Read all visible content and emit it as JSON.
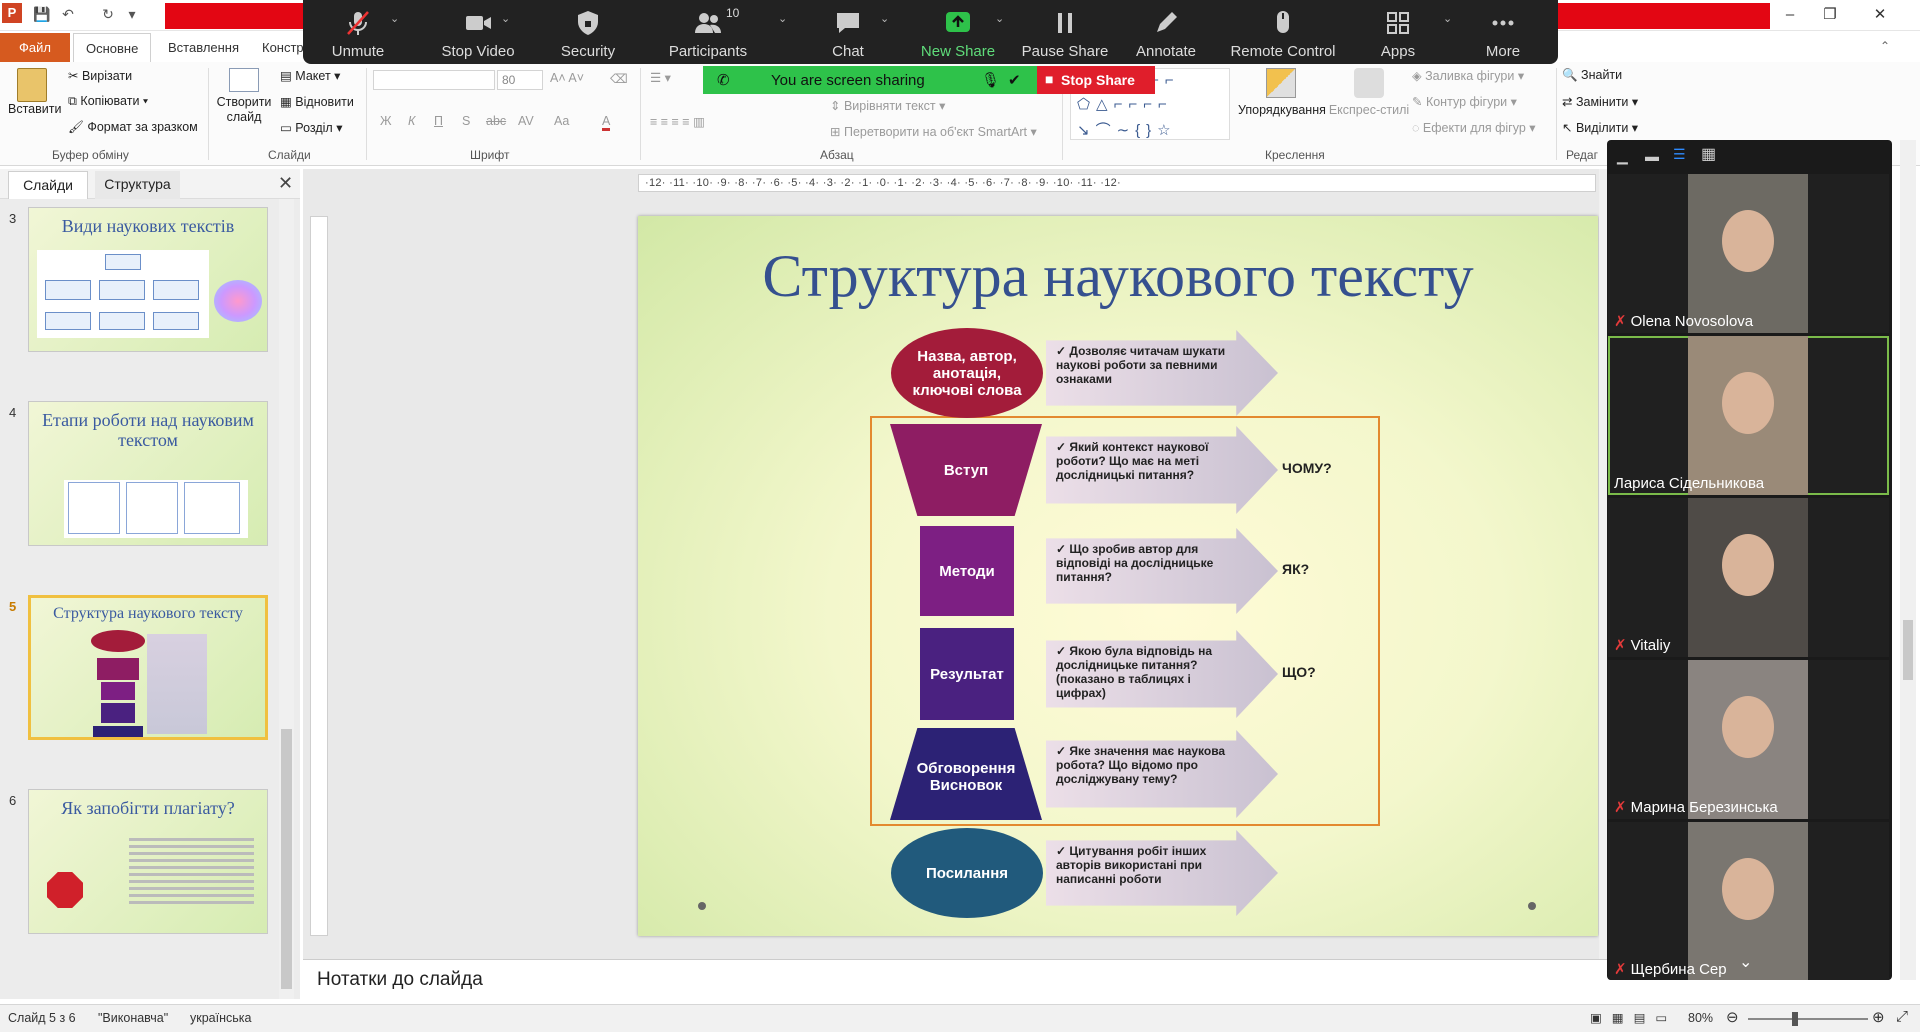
{
  "app": {
    "icon_letter": "P",
    "window_controls": [
      "–",
      "❐",
      "✕"
    ]
  },
  "tabs": [
    "Файл",
    "Основне",
    "Вставлення",
    "Констр"
  ],
  "ribbon": {
    "clipboard": {
      "paste": "Вставити",
      "cut": "Вирізати",
      "copy": "Копіювати",
      "format": "Формат за зразком",
      "group": "Буфер обміну"
    },
    "slides": {
      "new_slide": "Створити слайд",
      "layout": "Макет",
      "reset": "Відновити",
      "section": "Розділ",
      "group": "Слайди"
    },
    "font": {
      "size": "80",
      "group": "Шрифт",
      "buttons": [
        "Ж",
        "К",
        "П",
        "S",
        "abc",
        "AV",
        "Aa",
        "A"
      ]
    },
    "paragraph": {
      "group": "Абзац",
      "align_text": "Вирівняти текст",
      "smartart": "Перетворити на об'єкт SmartArt"
    },
    "drawing": {
      "group": "Креслення",
      "arrange": "Упорядкування",
      "quick_styles": "Експрес-стилі",
      "fill": "Заливка фігури",
      "outline": "Контур фігури",
      "effects": "Ефекти для фігур"
    },
    "editing": {
      "find": "Знайти",
      "replace": "Замінити",
      "select": "Виділити",
      "group": "Редаг"
    }
  },
  "zoom": {
    "buttons": [
      {
        "id": "unmute",
        "label": "Unmute",
        "icon": "mic-off-icon"
      },
      {
        "id": "stop-video",
        "label": "Stop Video",
        "icon": "video-camera-icon"
      },
      {
        "id": "security",
        "label": "Security",
        "icon": "shield-icon"
      },
      {
        "id": "participants",
        "label": "Participants",
        "icon": "people-icon",
        "count": "10"
      },
      {
        "id": "chat",
        "label": "Chat",
        "icon": "chat-bubble-icon"
      },
      {
        "id": "new-share",
        "label": "New Share",
        "icon": "share-arrow-icon"
      },
      {
        "id": "pause-share",
        "label": "Pause Share",
        "icon": "pause-icon"
      },
      {
        "id": "annotate",
        "label": "Annotate",
        "icon": "pen-icon"
      },
      {
        "id": "remote-control",
        "label": "Remote Control",
        "icon": "mouse-icon"
      },
      {
        "id": "apps",
        "label": "Apps",
        "icon": "apps-icon"
      },
      {
        "id": "more",
        "label": "More",
        "icon": "ellipsis-icon"
      }
    ],
    "sharing_text": "You are screen sharing",
    "stop_share": "Stop Share",
    "accent": "#2ec24a"
  },
  "slides_pane": {
    "tab_slides": "Слайди",
    "tab_outline": "Структура",
    "thumbs": [
      {
        "num": "3",
        "title": "Види наукових текстів"
      },
      {
        "num": "4",
        "title": "Етапи роботи  над науковим текстом"
      },
      {
        "num": "5",
        "title": "Структура наукового  тексту"
      },
      {
        "num": "6",
        "title": "Як запобігти плагіату?"
      }
    ]
  },
  "ruler": {
    "h": "·12·  ·11·  ·10·  ·9·  ·8·  ·7·  ·6·  ·5·  ·4·  ·3·  ·2·  ·1·  ·0·  ·1·  ·2·  ·3·  ·4·  ·5·  ·6·  ·7·  ·8·  ·9·  ·10·  ·11·  ·12·"
  },
  "slide": {
    "title": "Структура наукового тексту",
    "sections": [
      {
        "shape": "ellipse",
        "label": "Назва, автор, анотація, ключові слова",
        "color": "#a31c3a",
        "text": "Дозволяє читачам шукати наукові роботи за певними ознаками",
        "question": ""
      },
      {
        "shape": "trap-down",
        "label": "Вступ",
        "color": "#8e1d63",
        "text": "Який контекст наукової роботи? Що має на меті дослідницькі питання?",
        "question": "ЧОМУ?"
      },
      {
        "shape": "rect",
        "label": "Методи",
        "color": "#7d1f83",
        "text": "Що зробив автор для відповіді на дослідницьке питання?",
        "question": "ЯК?"
      },
      {
        "shape": "rect",
        "label": "Результат",
        "color": "#4a2180",
        "text": "Якою була відповідь на дослідницьке питання? (показано в таблицях і цифрах)",
        "question": "ЩО?"
      },
      {
        "shape": "trap-up",
        "label": "Обговорення Висновок",
        "color": "#2c2275",
        "text": "Яке значення має наукова робота? Що відомо про досліджувану тему?",
        "question": ""
      },
      {
        "shape": "ellipse",
        "label": "Посилання",
        "color": "#215a7c",
        "text": "Цитування робіт інших авторів використані при написанні роботи",
        "question": ""
      }
    ]
  },
  "notes_placeholder": "Нотатки до слайда",
  "status": {
    "slide": "Слайд 5 з 6",
    "theme": "\"Виконавча\"",
    "lang": "українська",
    "zoom": "80%"
  },
  "participants": [
    {
      "name": "Olena Novosolova",
      "muted": true,
      "bg": "#6d6a63"
    },
    {
      "name": "Лариса Сідельникова",
      "muted": false,
      "bg": "#9a8a78"
    },
    {
      "name": "Vitaliy",
      "muted": true,
      "bg": "#4f4b47"
    },
    {
      "name": "Марина Березинська",
      "muted": true,
      "bg": "#8a8480"
    },
    {
      "name": "Щербина Сер",
      "muted": true,
      "bg": "#7a7670"
    }
  ]
}
